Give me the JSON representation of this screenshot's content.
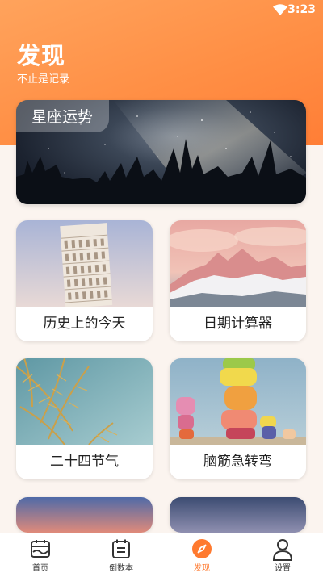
{
  "status_bar": {
    "time": "3:23",
    "wifi_icon": "wifi-icon"
  },
  "header": {
    "title": "发现",
    "subtitle": "不止是记录"
  },
  "banner": {
    "label": "星座运势"
  },
  "cards": [
    {
      "label": "历史上的今天"
    },
    {
      "label": "日期计算器"
    },
    {
      "label": "二十四节气"
    },
    {
      "label": "脑筋急转弯"
    }
  ],
  "bottom_nav": {
    "items": [
      {
        "label": "首页",
        "icon": "calendar-home-icon"
      },
      {
        "label": "倒数本",
        "icon": "countdown-book-icon"
      },
      {
        "label": "发现",
        "icon": "compass-icon",
        "active": true
      },
      {
        "label": "设置",
        "icon": "user-icon"
      }
    ]
  },
  "colors": {
    "accent": "#ff7a2f",
    "header_start": "#ffa35c",
    "header_end": "#ff7e36"
  }
}
